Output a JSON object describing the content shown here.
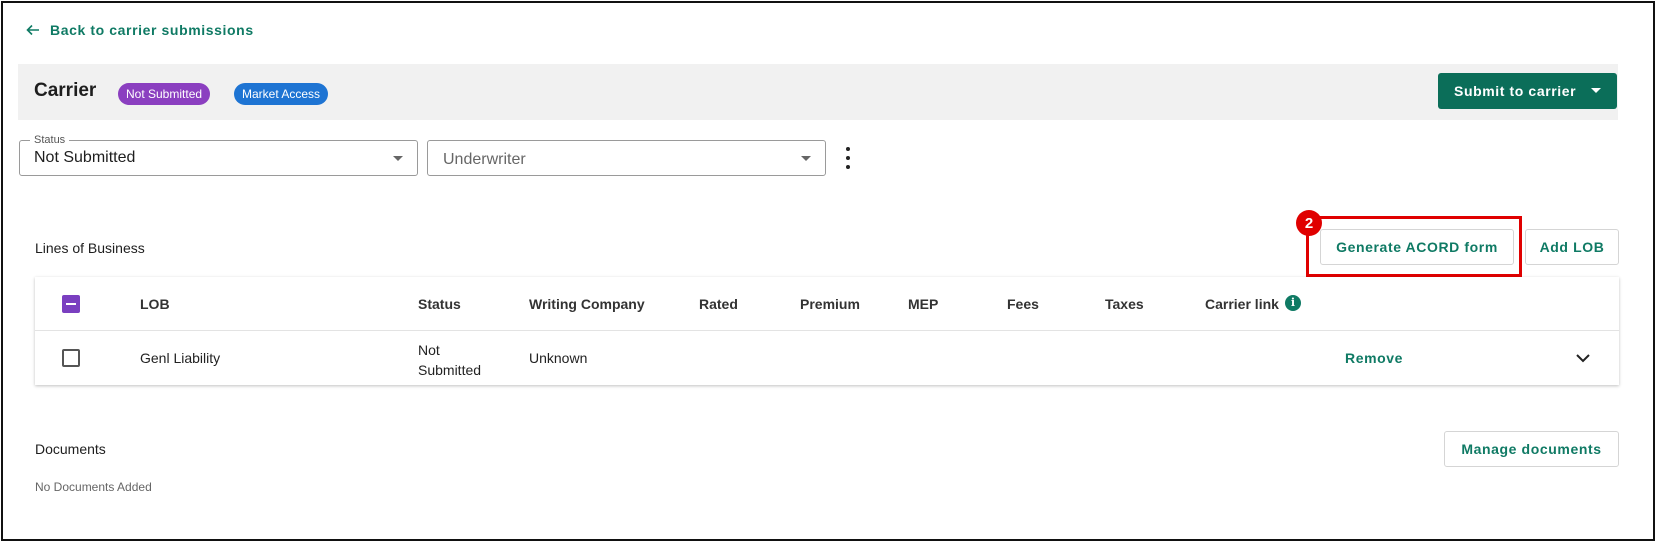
{
  "nav": {
    "back_label": "Back to carrier submissions"
  },
  "header": {
    "title": "Carrier",
    "badges": [
      "Not Submitted",
      "Market Access"
    ],
    "submit_label": "Submit to carrier"
  },
  "filters": {
    "status_legend": "Status",
    "status_value": "Not Submitted",
    "underwriter_placeholder": "Underwriter"
  },
  "lob_section": {
    "title": "Lines of Business",
    "generate_label": "Generate ACORD form",
    "add_label": "Add LOB",
    "columns": [
      "LOB",
      "Status",
      "Writing Company",
      "Rated",
      "Premium",
      "MEP",
      "Fees",
      "Taxes",
      "Carrier link"
    ],
    "rows": [
      {
        "lob": "Genl Liability",
        "status_line1": "Not",
        "status_line2": "Submitted",
        "writing_company": "Unknown",
        "action": "Remove"
      }
    ]
  },
  "annotation": {
    "step": "2"
  },
  "documents": {
    "title": "Documents",
    "manage_label": "Manage documents",
    "empty_text": "No Documents Added"
  },
  "colors": {
    "accent": "#0b6e59",
    "badge_purple": "#8b3fc0",
    "badge_blue": "#1e74d3",
    "highlight": "#e00000"
  },
  "icons": [
    "arrow-left-icon",
    "caret-down-icon",
    "kebab-icon",
    "info-icon",
    "chevron-down-icon"
  ]
}
